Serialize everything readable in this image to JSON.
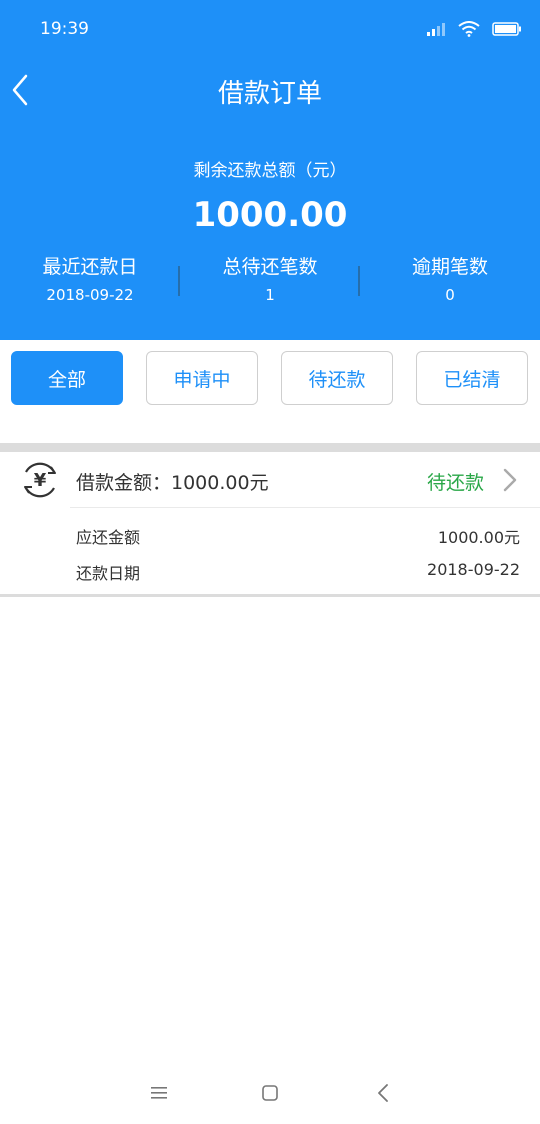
{
  "status_bar": {
    "time": "19:39"
  },
  "nav": {
    "title": "借款订单"
  },
  "summary": {
    "remain_label": "剩余还款总额（元）",
    "remain_amount": "1000.00",
    "stats": [
      {
        "label": "最近还款日",
        "value": "2018-09-22"
      },
      {
        "label": "总待还笔数",
        "value": "1"
      },
      {
        "label": "逾期笔数",
        "value": "0"
      }
    ]
  },
  "filters": [
    {
      "label": "全部",
      "active": true
    },
    {
      "label": "申请中",
      "active": false
    },
    {
      "label": "待还款",
      "active": false
    },
    {
      "label": "已结清",
      "active": false
    }
  ],
  "order": {
    "icon_char": "¥",
    "title": "借款金额：1000.00元",
    "status": "待还款",
    "details": [
      {
        "label": "应还金额",
        "value": "1000.00元"
      },
      {
        "label": "还款日期",
        "value": "2018-09-22"
      }
    ]
  },
  "colors": {
    "brand_blue": "#1e90f8",
    "status_green": "#2aa748",
    "text_dark": "#333333"
  },
  "icons": [
    "signal-icon",
    "wifi-icon",
    "battery-icon",
    "back-arrow-icon",
    "yuan-refresh-icon",
    "chevron-right-icon",
    "menu-icon",
    "home-icon",
    "back-icon"
  ]
}
